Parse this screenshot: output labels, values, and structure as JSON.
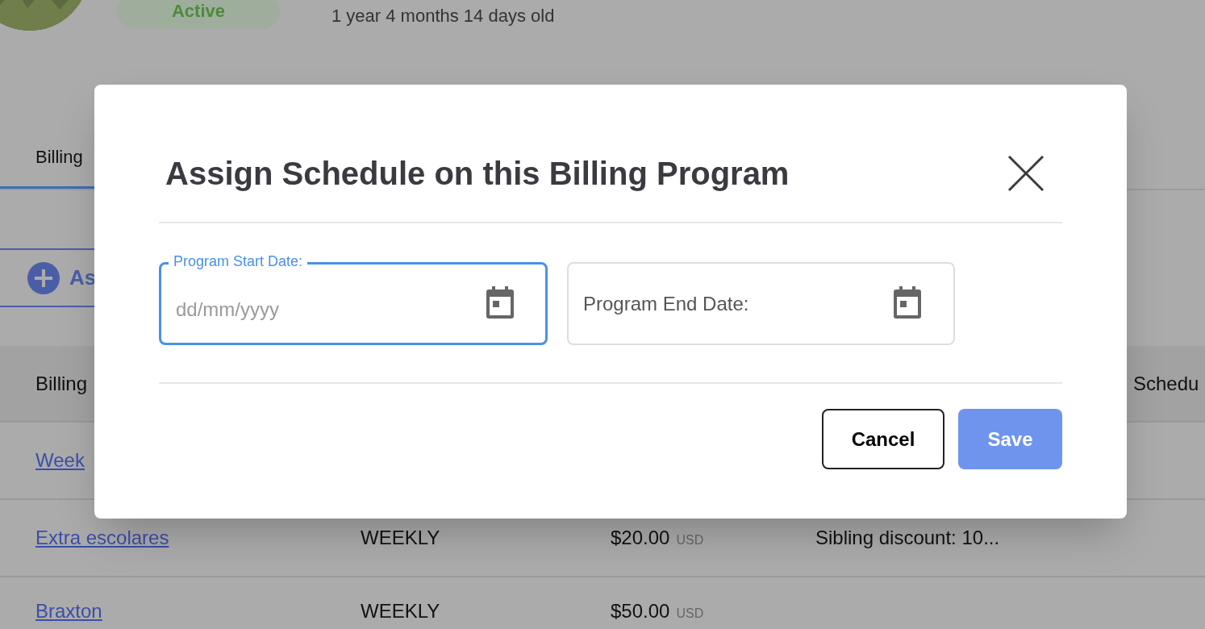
{
  "profile": {
    "status_badge": "Active",
    "age": "1 year 4 months 14 days old"
  },
  "tabs": [
    {
      "label": "Billing",
      "selected": true
    }
  ],
  "assign_button": {
    "label": "As"
  },
  "table": {
    "columns": [
      "Billing",
      "Schedu"
    ],
    "rows": [
      {
        "name": "Week"
      },
      {
        "name": "Extra escolares",
        "frequency": "WEEKLY",
        "amount": "$20.00",
        "currency": "USD",
        "discount": "Sibling discount: 10..."
      },
      {
        "name": "Braxton",
        "frequency": "WEEKLY",
        "amount": "$50.00",
        "currency": "USD"
      }
    ]
  },
  "modal": {
    "title": "Assign Schedule on this Billing Program",
    "fields": [
      {
        "label": "Program Start Date:",
        "placeholder": "dd/mm/yyyy",
        "focused": true
      },
      {
        "label": "Program End Date:",
        "focused": false
      }
    ],
    "buttons": [
      {
        "label": "Cancel",
        "kind": "secondary"
      },
      {
        "label": "Save",
        "kind": "primary",
        "disabled": true
      }
    ]
  }
}
